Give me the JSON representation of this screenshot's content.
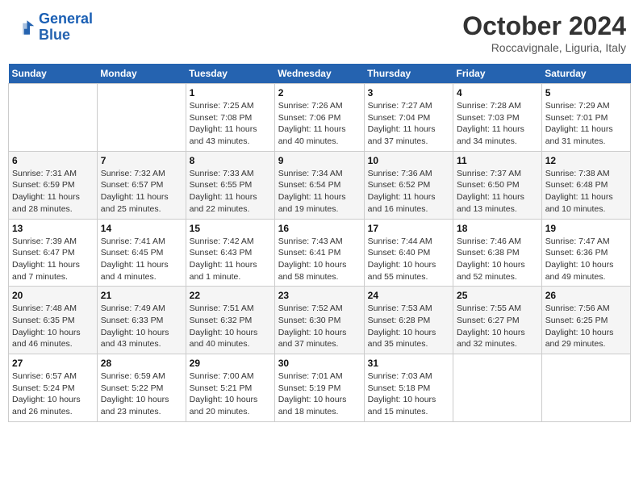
{
  "logo": {
    "line1": "General",
    "line2": "Blue"
  },
  "title": "October 2024",
  "subtitle": "Roccavignale, Liguria, Italy",
  "days_of_week": [
    "Sunday",
    "Monday",
    "Tuesday",
    "Wednesday",
    "Thursday",
    "Friday",
    "Saturday"
  ],
  "weeks": [
    [
      {
        "day": "",
        "content": ""
      },
      {
        "day": "",
        "content": ""
      },
      {
        "day": "1",
        "sunrise": "Sunrise: 7:25 AM",
        "sunset": "Sunset: 7:08 PM",
        "daylight": "Daylight: 11 hours and 43 minutes."
      },
      {
        "day": "2",
        "sunrise": "Sunrise: 7:26 AM",
        "sunset": "Sunset: 7:06 PM",
        "daylight": "Daylight: 11 hours and 40 minutes."
      },
      {
        "day": "3",
        "sunrise": "Sunrise: 7:27 AM",
        "sunset": "Sunset: 7:04 PM",
        "daylight": "Daylight: 11 hours and 37 minutes."
      },
      {
        "day": "4",
        "sunrise": "Sunrise: 7:28 AM",
        "sunset": "Sunset: 7:03 PM",
        "daylight": "Daylight: 11 hours and 34 minutes."
      },
      {
        "day": "5",
        "sunrise": "Sunrise: 7:29 AM",
        "sunset": "Sunset: 7:01 PM",
        "daylight": "Daylight: 11 hours and 31 minutes."
      }
    ],
    [
      {
        "day": "6",
        "sunrise": "Sunrise: 7:31 AM",
        "sunset": "Sunset: 6:59 PM",
        "daylight": "Daylight: 11 hours and 28 minutes."
      },
      {
        "day": "7",
        "sunrise": "Sunrise: 7:32 AM",
        "sunset": "Sunset: 6:57 PM",
        "daylight": "Daylight: 11 hours and 25 minutes."
      },
      {
        "day": "8",
        "sunrise": "Sunrise: 7:33 AM",
        "sunset": "Sunset: 6:55 PM",
        "daylight": "Daylight: 11 hours and 22 minutes."
      },
      {
        "day": "9",
        "sunrise": "Sunrise: 7:34 AM",
        "sunset": "Sunset: 6:54 PM",
        "daylight": "Daylight: 11 hours and 19 minutes."
      },
      {
        "day": "10",
        "sunrise": "Sunrise: 7:36 AM",
        "sunset": "Sunset: 6:52 PM",
        "daylight": "Daylight: 11 hours and 16 minutes."
      },
      {
        "day": "11",
        "sunrise": "Sunrise: 7:37 AM",
        "sunset": "Sunset: 6:50 PM",
        "daylight": "Daylight: 11 hours and 13 minutes."
      },
      {
        "day": "12",
        "sunrise": "Sunrise: 7:38 AM",
        "sunset": "Sunset: 6:48 PM",
        "daylight": "Daylight: 11 hours and 10 minutes."
      }
    ],
    [
      {
        "day": "13",
        "sunrise": "Sunrise: 7:39 AM",
        "sunset": "Sunset: 6:47 PM",
        "daylight": "Daylight: 11 hours and 7 minutes."
      },
      {
        "day": "14",
        "sunrise": "Sunrise: 7:41 AM",
        "sunset": "Sunset: 6:45 PM",
        "daylight": "Daylight: 11 hours and 4 minutes."
      },
      {
        "day": "15",
        "sunrise": "Sunrise: 7:42 AM",
        "sunset": "Sunset: 6:43 PM",
        "daylight": "Daylight: 11 hours and 1 minute."
      },
      {
        "day": "16",
        "sunrise": "Sunrise: 7:43 AM",
        "sunset": "Sunset: 6:41 PM",
        "daylight": "Daylight: 10 hours and 58 minutes."
      },
      {
        "day": "17",
        "sunrise": "Sunrise: 7:44 AM",
        "sunset": "Sunset: 6:40 PM",
        "daylight": "Daylight: 10 hours and 55 minutes."
      },
      {
        "day": "18",
        "sunrise": "Sunrise: 7:46 AM",
        "sunset": "Sunset: 6:38 PM",
        "daylight": "Daylight: 10 hours and 52 minutes."
      },
      {
        "day": "19",
        "sunrise": "Sunrise: 7:47 AM",
        "sunset": "Sunset: 6:36 PM",
        "daylight": "Daylight: 10 hours and 49 minutes."
      }
    ],
    [
      {
        "day": "20",
        "sunrise": "Sunrise: 7:48 AM",
        "sunset": "Sunset: 6:35 PM",
        "daylight": "Daylight: 10 hours and 46 minutes."
      },
      {
        "day": "21",
        "sunrise": "Sunrise: 7:49 AM",
        "sunset": "Sunset: 6:33 PM",
        "daylight": "Daylight: 10 hours and 43 minutes."
      },
      {
        "day": "22",
        "sunrise": "Sunrise: 7:51 AM",
        "sunset": "Sunset: 6:32 PM",
        "daylight": "Daylight: 10 hours and 40 minutes."
      },
      {
        "day": "23",
        "sunrise": "Sunrise: 7:52 AM",
        "sunset": "Sunset: 6:30 PM",
        "daylight": "Daylight: 10 hours and 37 minutes."
      },
      {
        "day": "24",
        "sunrise": "Sunrise: 7:53 AM",
        "sunset": "Sunset: 6:28 PM",
        "daylight": "Daylight: 10 hours and 35 minutes."
      },
      {
        "day": "25",
        "sunrise": "Sunrise: 7:55 AM",
        "sunset": "Sunset: 6:27 PM",
        "daylight": "Daylight: 10 hours and 32 minutes."
      },
      {
        "day": "26",
        "sunrise": "Sunrise: 7:56 AM",
        "sunset": "Sunset: 6:25 PM",
        "daylight": "Daylight: 10 hours and 29 minutes."
      }
    ],
    [
      {
        "day": "27",
        "sunrise": "Sunrise: 6:57 AM",
        "sunset": "Sunset: 5:24 PM",
        "daylight": "Daylight: 10 hours and 26 minutes."
      },
      {
        "day": "28",
        "sunrise": "Sunrise: 6:59 AM",
        "sunset": "Sunset: 5:22 PM",
        "daylight": "Daylight: 10 hours and 23 minutes."
      },
      {
        "day": "29",
        "sunrise": "Sunrise: 7:00 AM",
        "sunset": "Sunset: 5:21 PM",
        "daylight": "Daylight: 10 hours and 20 minutes."
      },
      {
        "day": "30",
        "sunrise": "Sunrise: 7:01 AM",
        "sunset": "Sunset: 5:19 PM",
        "daylight": "Daylight: 10 hours and 18 minutes."
      },
      {
        "day": "31",
        "sunrise": "Sunrise: 7:03 AM",
        "sunset": "Sunset: 5:18 PM",
        "daylight": "Daylight: 10 hours and 15 minutes."
      },
      {
        "day": "",
        "content": ""
      },
      {
        "day": "",
        "content": ""
      }
    ]
  ]
}
